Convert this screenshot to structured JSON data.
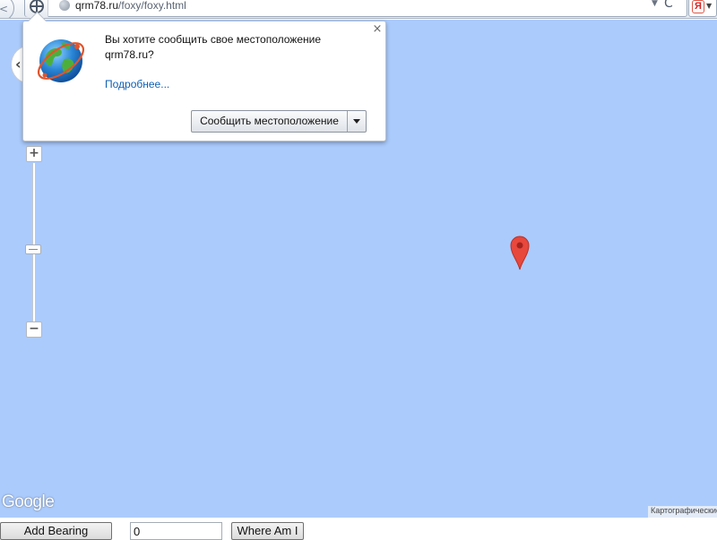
{
  "browser": {
    "url_host": "qrm78.ru",
    "url_path": "/foxy/foxy.html",
    "back_glyph": "<",
    "dropdown_glyph": "▼",
    "reload_glyph": "C",
    "search_engine_glyph": "Я"
  },
  "geolocation_prompt": {
    "message": "Вы хотите сообщить свое местоположение qrm78.ru?",
    "learn_more": "Подробнее...",
    "share_label": "Сообщить местоположение",
    "close_glyph": "×"
  },
  "map": {
    "pan_glyph": "‹",
    "zoom_in": "+",
    "zoom_out": "−",
    "logo": "Google",
    "attribution": "Картографические данные",
    "water_color": "#abcbfd",
    "marker_color": "#e8473c"
  },
  "controls": {
    "add_bearing_label": "Add Bearing",
    "bearing_value": "0",
    "where_am_i_label": "Where Am I"
  }
}
